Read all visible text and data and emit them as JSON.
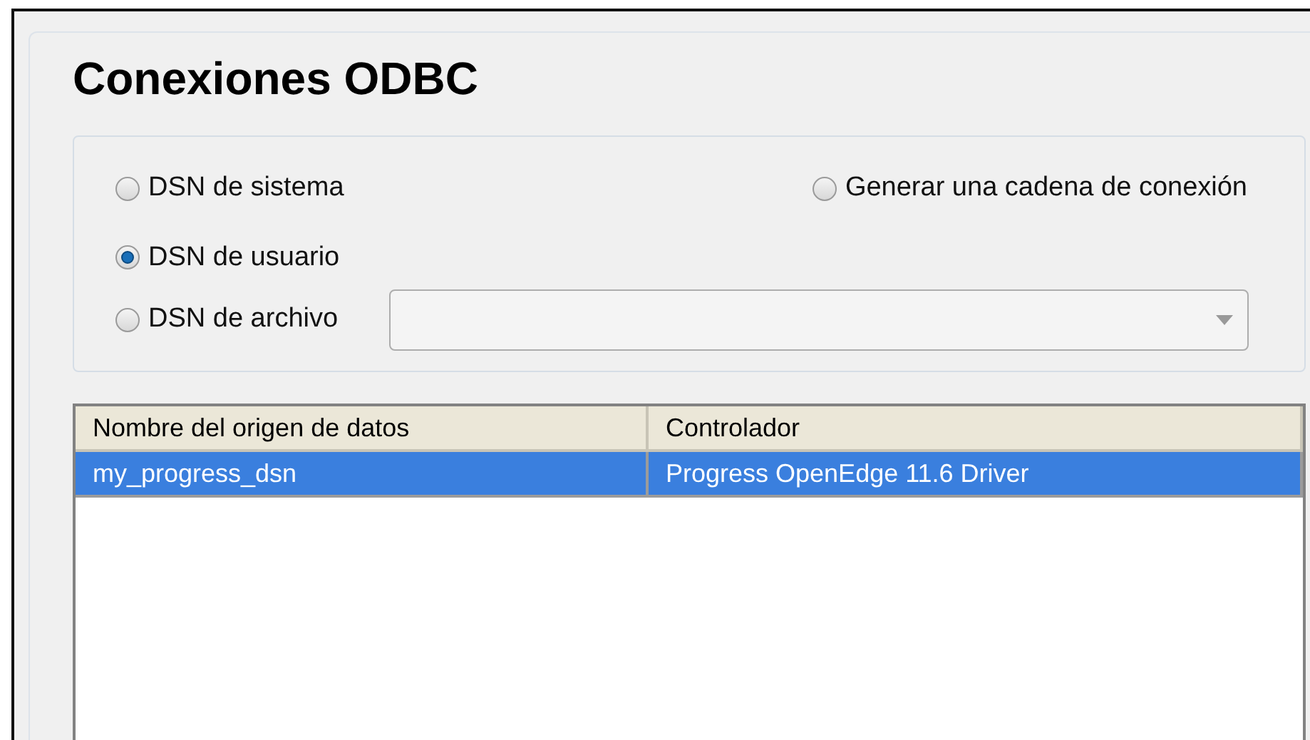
{
  "title": "Conexiones ODBC",
  "options": [
    {
      "label": "DSN de sistema",
      "selected": false
    },
    {
      "label": "DSN de usuario",
      "selected": true
    },
    {
      "label": "DSN de archivo",
      "selected": false
    },
    {
      "label": "Generar una cadena de conexión",
      "selected": false
    }
  ],
  "table": {
    "columns": [
      "Nombre del origen de datos",
      "Controlador"
    ],
    "rows": [
      {
        "cells": [
          "my_progress_dsn",
          "Progress OpenEdge 11.6 Driver"
        ],
        "selected": true
      }
    ]
  }
}
